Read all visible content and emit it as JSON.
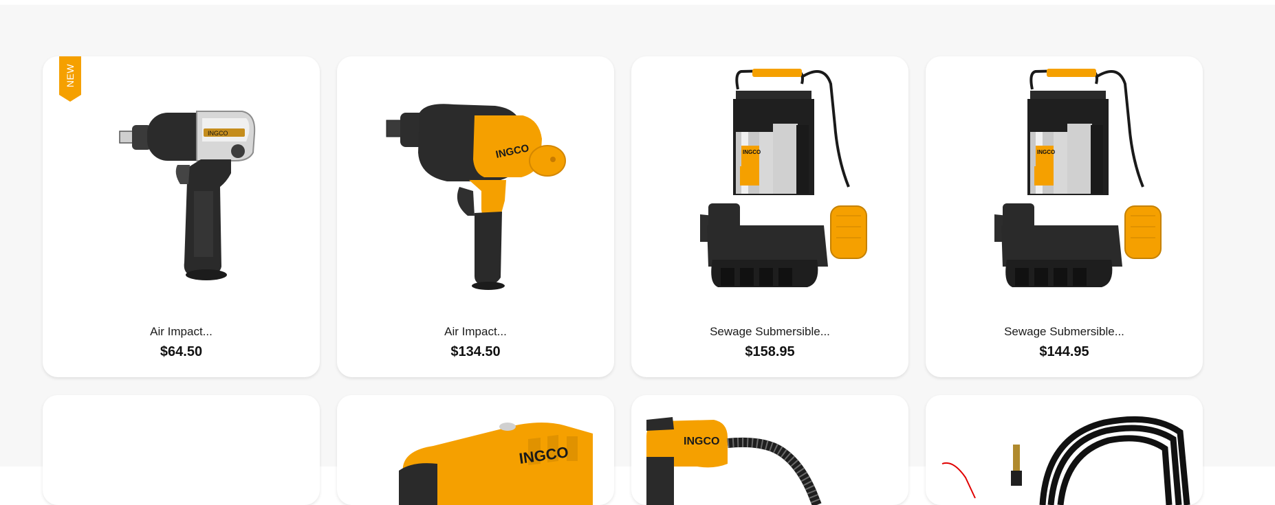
{
  "colors": {
    "page_background": "#f7f7f7",
    "card_background": "#ffffff",
    "brand_orange": "#f5a000",
    "text_dark": "#111111"
  },
  "products": [
    {
      "name": "Air Impact...",
      "price": "$64.50",
      "badge": "NEW",
      "image_logo": "INGCO",
      "icon": "air-impact-wrench-silver-image"
    },
    {
      "name": "Air Impact...",
      "price": "$134.50",
      "image_logo": "INGCO",
      "icon": "air-impact-wrench-orange-image"
    },
    {
      "name": "Sewage Submersible...",
      "price": "$158.95",
      "image_logo": "INGCO",
      "icon": "sewage-pump-image"
    },
    {
      "name": "Sewage Submersible...",
      "price": "$144.95",
      "image_logo": "INGCO",
      "icon": "sewage-pump-image"
    }
  ],
  "second_row": [
    {
      "icon": "blank-product-image"
    },
    {
      "icon": "orange-power-tool-image",
      "image_logo": "INGCO"
    },
    {
      "icon": "spray-gun-hose-image",
      "image_logo": "INGCO"
    },
    {
      "icon": "coiled-hose-image"
    }
  ]
}
